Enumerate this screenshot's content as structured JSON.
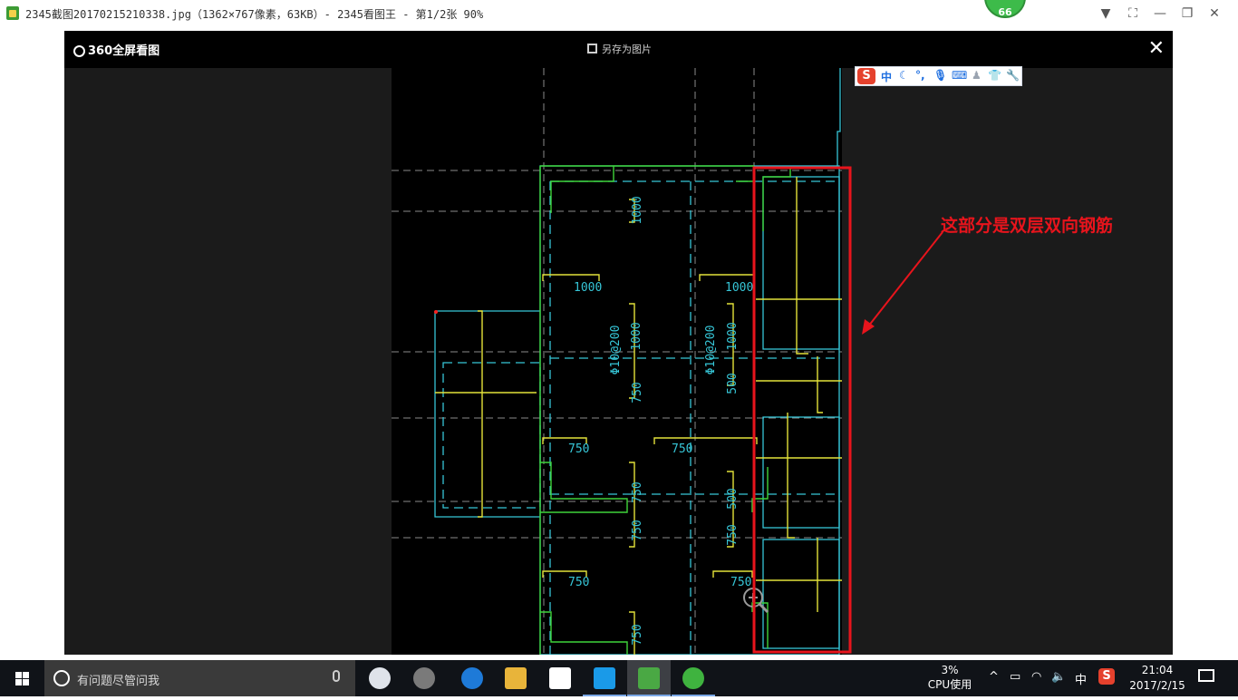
{
  "window": {
    "title": "2345截图20170215210338.jpg（1362×767像素，63KB）- 2345看图王 - 第1/2张 90%",
    "badge_value": "66",
    "menu_icon": "chevron-down-icon",
    "fullscreen_icon": "fullscreen-icon",
    "minimize_icon": "minimize-icon",
    "restore_icon": "restore-icon",
    "close_icon": "close-icon"
  },
  "viewer": {
    "logo_text": "360全屏看图",
    "save_label": "另存为图片",
    "close_glyph": "✕",
    "zoom_icon": "zoom-in-icon"
  },
  "ime": {
    "logo": "S",
    "mode": "中",
    "items": [
      "moon-icon",
      "punctuation-icon",
      "mic-icon",
      "keyboard-icon",
      "user-icon",
      "shirt-icon",
      "wrench-icon"
    ]
  },
  "annotation": {
    "text": "这部分是双层双向钢筋",
    "color": "#e8141c"
  },
  "drawing": {
    "labels": [
      {
        "text": "1000",
        "orient": "v"
      },
      {
        "text": "1000",
        "orient": "h"
      },
      {
        "text": "1000",
        "orient": "h"
      },
      {
        "text": "Φ10@200",
        "orient": "v"
      },
      {
        "text": "1000",
        "orient": "v"
      },
      {
        "text": "Φ10@200",
        "orient": "v"
      },
      {
        "text": "1000",
        "orient": "v"
      },
      {
        "text": "750",
        "orient": "v"
      },
      {
        "text": "500",
        "orient": "v"
      },
      {
        "text": "750",
        "orient": "h"
      },
      {
        "text": "750",
        "orient": "h"
      },
      {
        "text": "750",
        "orient": "v"
      },
      {
        "text": "500",
        "orient": "v"
      },
      {
        "text": "750",
        "orient": "v"
      },
      {
        "text": "750",
        "orient": "v"
      },
      {
        "text": "750",
        "orient": "h"
      },
      {
        "text": "750",
        "orient": "h"
      },
      {
        "text": "750",
        "orient": "v"
      }
    ],
    "colors": {
      "cyan": "#36c5d6",
      "yellow": "#e3e23a",
      "green": "#3fd43a",
      "grey": "#8a8a8a"
    }
  },
  "taskbar": {
    "start_icon": "windows-start-icon",
    "search_placeholder": "有问题尽管问我",
    "apps": [
      {
        "name": "taskbar-app-1",
        "icon": "flower-app-icon",
        "color": "#dfe3ea"
      },
      {
        "name": "taskbar-app-2",
        "icon": "browser-bell-icon",
        "color": "#7a7a7a"
      },
      {
        "name": "taskbar-app-3",
        "icon": "edge-icon",
        "color": "#1e7ad8"
      },
      {
        "name": "taskbar-app-4",
        "icon": "folder-icon",
        "color": "#e8b43a"
      },
      {
        "name": "taskbar-app-5",
        "icon": "store-icon",
        "color": "#ffffff"
      },
      {
        "name": "taskbar-app-6",
        "icon": "plus-app-icon",
        "color": "#1a9ae8"
      },
      {
        "name": "taskbar-app-7",
        "icon": "image-viewer-icon",
        "color": "#4aa844"
      },
      {
        "name": "taskbar-app-8",
        "icon": "refresh-app-icon",
        "color": "#3fb33f"
      }
    ],
    "cpu_value": "3%",
    "cpu_label": "CPU使用",
    "tray_chevron": "^",
    "tray_ime": "中",
    "time": "21:04",
    "date": "2017/2/15"
  }
}
